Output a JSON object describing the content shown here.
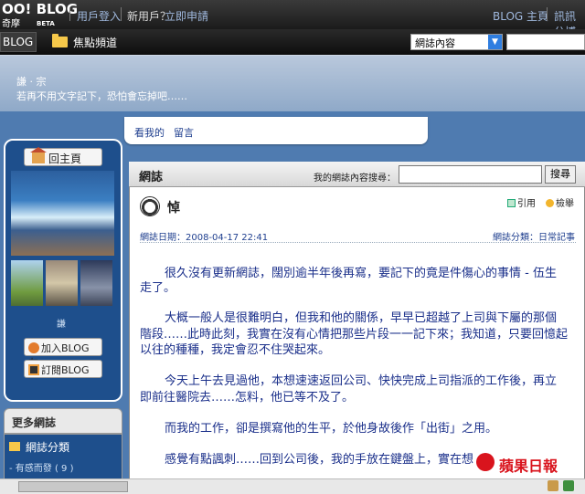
{
  "topbar": {
    "logo_main": "OO!",
    "logo_blog": "BLOG",
    "logo_sub": "奇摩",
    "logo_beta": "BETA",
    "login": "用戶登入",
    "new_user": "新用戶？",
    "register": "立即申請",
    "blog_home": "BLOG 主頁",
    "right_link": "訊訊分博"
  },
  "navbar": {
    "blog_button": "BLOG",
    "focus_channel": "焦點頻道",
    "select_value": "網誌內容"
  },
  "header": {
    "title": "謙 · 宗",
    "subtitle": "若再不用文字記下，恐怕會忘掉吧……"
  },
  "tabs": [
    "看我的",
    "留言"
  ],
  "sidebar": {
    "home_button": "回主頁",
    "small_text": "謙",
    "add_friend": "加入BLOG 友",
    "subscribe": "訂閱BLOG",
    "more_title": "更多網誌",
    "category_label": "網誌分類",
    "category_sub": "- 有感而發 ( 9 )"
  },
  "main": {
    "header_title": "網誌",
    "search_label": "我的網誌內容搜尋：",
    "search_button": "搜尋",
    "post_title": "悼",
    "quote": "引用",
    "report": "檢舉",
    "date": "網誌日期：2008-04-17 22:41",
    "category": "網誌分類：日常記事",
    "paragraphs": [
      [
        "很久沒有更新網誌，闊別逾半年後再寫，要記下的竟是件傷心的事情 - 伍生",
        "走了。"
      ],
      [
        "大概一般人是很難明白，但我和他的關係，早早已超越了上司與下屬的那個",
        "階段……此時此刻，我實在沒有心情把那些片段一一記下來；我知道，只要回憶起",
        "以往的種種，我定會忍不住哭起來。"
      ],
      [
        "今天上午去見過他，本想速速返回公司、快快完成上司指派的工作後，再立",
        "即前往醫院去……怎料，他已等不及了。"
      ],
      [
        "而我的工作，卻是撰寫他的生平，於他身故後作「出街」之用。"
      ],
      [
        "感覺有點諷刺……回到公司後，我的手放在鍵盤上，實在想"
      ]
    ]
  },
  "watermark": "蘋果日報"
}
